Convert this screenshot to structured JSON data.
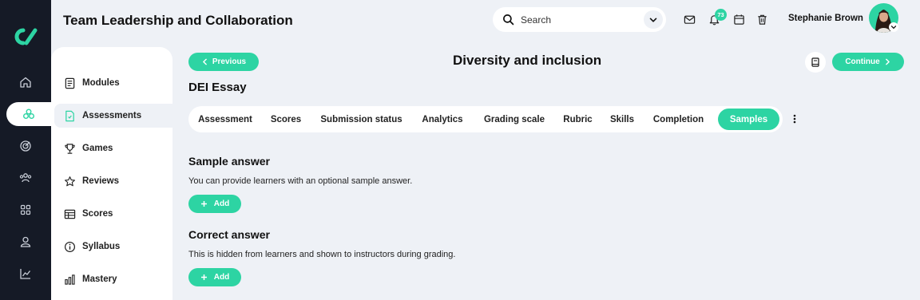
{
  "app": {
    "course_title": "Team Leadership and Collaboration"
  },
  "search": {
    "placeholder": "Search"
  },
  "notifications": {
    "count": "73"
  },
  "user": {
    "name": "Stephanie Brown"
  },
  "rail": {
    "items": [
      {
        "icon": "home-icon"
      },
      {
        "icon": "learning-hub-icon",
        "active": true
      },
      {
        "icon": "target-icon"
      },
      {
        "icon": "people-icon"
      },
      {
        "icon": "apps-grid-icon"
      },
      {
        "icon": "user-icon"
      },
      {
        "icon": "analytics-icon"
      }
    ]
  },
  "sidebar": {
    "items": [
      {
        "label": "Modules",
        "icon": "modules-icon"
      },
      {
        "label": "Assessments",
        "icon": "assessment-doc-icon",
        "active": true
      },
      {
        "label": "Games",
        "icon": "trophy-icon"
      },
      {
        "label": "Reviews",
        "icon": "star-icon"
      },
      {
        "label": "Scores",
        "icon": "table-icon"
      },
      {
        "label": "Syllabus",
        "icon": "info-icon"
      },
      {
        "label": "Mastery",
        "icon": "bar-chart-icon"
      }
    ]
  },
  "nav": {
    "previous_label": "Previous",
    "continue_label": "Continue"
  },
  "page": {
    "title": "Diversity and inclusion",
    "assessment_name": "DEI Essay"
  },
  "tabs": [
    {
      "label": "Assessment"
    },
    {
      "label": "Scores"
    },
    {
      "label": "Submission status"
    },
    {
      "label": "Analytics"
    },
    {
      "label": "Grading scale"
    },
    {
      "label": "Rubric"
    },
    {
      "label": "Skills"
    },
    {
      "label": "Completion"
    },
    {
      "label": "Samples",
      "active": true
    }
  ],
  "sections": {
    "sample": {
      "title": "Sample answer",
      "description": "You can provide learners with an optional sample answer.",
      "add_label": "Add"
    },
    "correct": {
      "title": "Correct answer",
      "description": "This is hidden from learners and shown to instructors during grading.",
      "add_label": "Add"
    }
  },
  "colors": {
    "accent": "#2dd4a3",
    "rail": "#151a26",
    "background": "#eef1f6"
  }
}
